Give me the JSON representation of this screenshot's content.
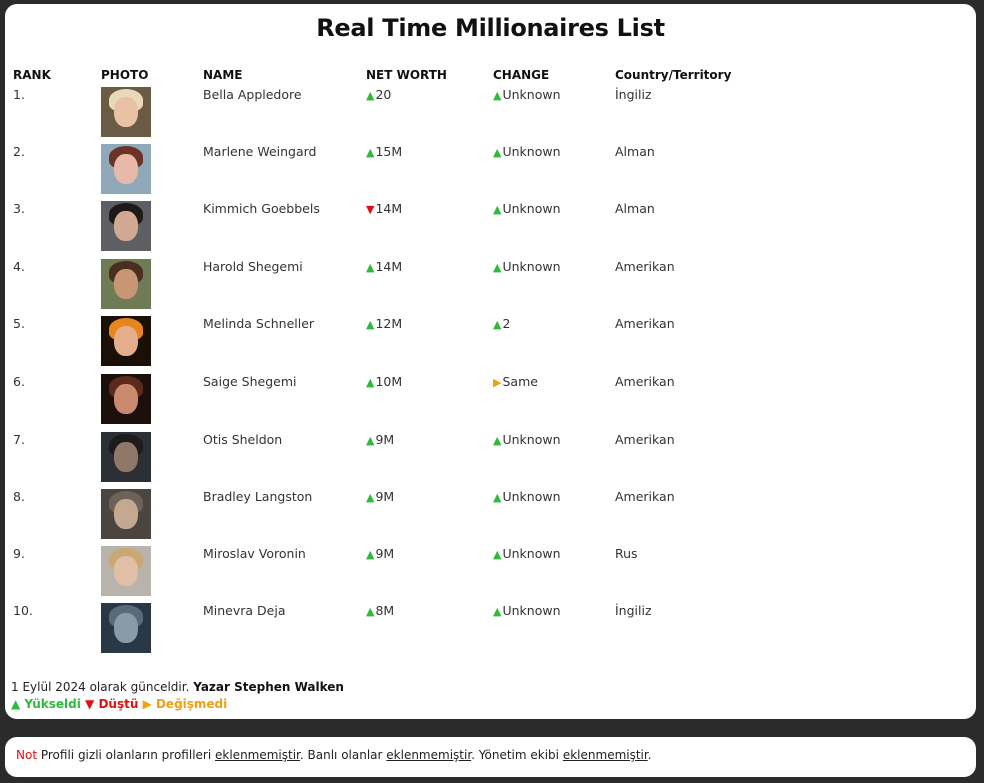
{
  "title": "Real Time Millionaires List",
  "headers": {
    "rank": "RANK",
    "photo": "PHOTO",
    "name": "NAME",
    "net_worth": "NET WORTH",
    "change": "CHANGE",
    "country": "Country/Territory"
  },
  "rows": [
    {
      "rank": "1.",
      "name": "Bella Appledore",
      "worth_dir": "up",
      "worth": "20",
      "change_dir": "up",
      "change": "Unknown",
      "country": "İngiliz",
      "photo_colors": {
        "bg": "#6b5a44",
        "skin": "#e9c2a6",
        "hair": "#e8d9b8"
      }
    },
    {
      "rank": "2.",
      "name": "Marlene Weingard",
      "worth_dir": "up",
      "worth": "15M",
      "change_dir": "up",
      "change": "Unknown",
      "country": "Alman",
      "photo_colors": {
        "bg": "#8fa9b8",
        "skin": "#e6b9a8",
        "hair": "#6a3324"
      }
    },
    {
      "rank": "3.",
      "name": "Kimmich Goebbels",
      "worth_dir": "down",
      "worth": "14M",
      "change_dir": "up",
      "change": "Unknown",
      "country": "Alman",
      "photo_colors": {
        "bg": "#5d5f62",
        "skin": "#d1a993",
        "hair": "#1e1a18"
      }
    },
    {
      "rank": "4.",
      "name": "Harold Shegemi",
      "worth_dir": "up",
      "worth": "14M",
      "change_dir": "up",
      "change": "Unknown",
      "country": "Amerikan",
      "photo_colors": {
        "bg": "#6f7a56",
        "skin": "#c89575",
        "hair": "#4a2f20"
      }
    },
    {
      "rank": "5.",
      "name": "Melinda Schneller",
      "worth_dir": "up",
      "worth": "12M",
      "change_dir": "up",
      "change": "2",
      "country": "Amerikan",
      "photo_colors": {
        "bg": "#1a1008",
        "skin": "#e4ad8c",
        "hair": "#e8861e"
      }
    },
    {
      "rank": "6.",
      "name": "Saige Shegemi",
      "worth_dir": "up",
      "worth": "10M",
      "change_dir": "same",
      "change": "Same",
      "country": "Amerikan",
      "photo_colors": {
        "bg": "#1c100c",
        "skin": "#c98a70",
        "hair": "#5a2a1a"
      }
    },
    {
      "rank": "7.",
      "name": "Otis Sheldon",
      "worth_dir": "up",
      "worth": "9M",
      "change_dir": "up",
      "change": "Unknown",
      "country": "Amerikan",
      "photo_colors": {
        "bg": "#2c2f33",
        "skin": "#8f7868",
        "hair": "#1c1c1c"
      }
    },
    {
      "rank": "8.",
      "name": "Bradley Langston",
      "worth_dir": "up",
      "worth": "9M",
      "change_dir": "up",
      "change": "Unknown",
      "country": "Amerikan",
      "photo_colors": {
        "bg": "#4a4540",
        "skin": "#c4a890",
        "hair": "#6e6258"
      }
    },
    {
      "rank": "9.",
      "name": "Miroslav Voronin",
      "worth_dir": "up",
      "worth": "9M",
      "change_dir": "up",
      "change": "Unknown",
      "country": "Rus",
      "photo_colors": {
        "bg": "#b8b4ac",
        "skin": "#e1bfa6",
        "hair": "#c9a874"
      }
    },
    {
      "rank": "10.",
      "name": "Minevra Deja",
      "worth_dir": "up",
      "worth": "8M",
      "change_dir": "up",
      "change": "Unknown",
      "country": "İngiliz",
      "photo_colors": {
        "bg": "#283846",
        "skin": "#8a9aa8",
        "hair": "#5a6a78"
      }
    }
  ],
  "footer": {
    "updated": "1 Eylül 2024 olarak günceldir.",
    "author": "Yazar Stephen Walken",
    "legend_up": "▲ Yükseldi",
    "legend_down": "▼ Düştü",
    "legend_same": "▶ Değişmedi"
  },
  "note": {
    "label": "Not",
    "t1": "Profili gizli olanların profilleri",
    "link1": "eklenmemiştir",
    "t2": ". Banlı olanlar",
    "link2": "eklenmemiştir",
    "t3": ". Yönetim ekibi",
    "link3": "eklenmemiştir",
    "t4": "."
  },
  "colors": {
    "up": "#2dbb3c",
    "down": "#e01010",
    "same": "#f0a010",
    "page_bg": "#2b2b2b"
  }
}
